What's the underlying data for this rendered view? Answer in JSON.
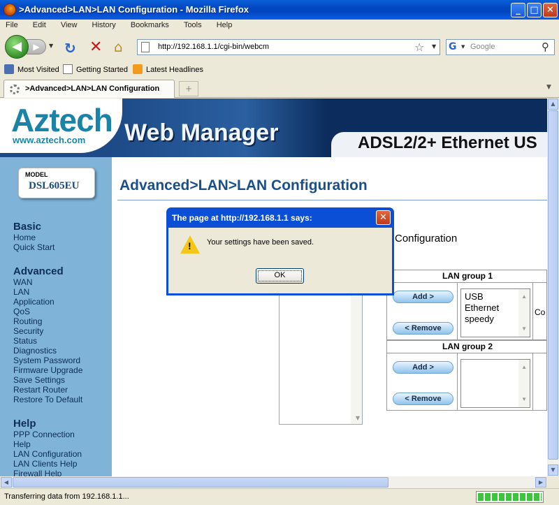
{
  "window": {
    "title": ">Advanced>LAN>LAN Configuration - Mozilla Firefox",
    "controls": {
      "minimize": "_",
      "maximize": "□",
      "close": "✕"
    }
  },
  "menu": [
    "File",
    "Edit",
    "View",
    "History",
    "Bookmarks",
    "Tools",
    "Help"
  ],
  "nav": {
    "url": "http://192.168.1.1/cgi-bin/webcm",
    "search_placeholder": "Google"
  },
  "bookmarks": [
    "Most Visited",
    "Getting Started",
    "Latest Headlines"
  ],
  "tab": {
    "label": ">Advanced>LAN>LAN Configuration",
    "new_tab": "+"
  },
  "banner": {
    "brand": "Aztech",
    "brand_url": "www.aztech.com",
    "product_line": "Web Manager",
    "product": "ADSL2/2+ Ethernet US"
  },
  "model": {
    "label": "MODEL",
    "name": "DSL605EU"
  },
  "sidebar": {
    "basic": {
      "title": "Basic",
      "items": [
        "Home",
        "Quick Start"
      ]
    },
    "advanced": {
      "title": "Advanced",
      "items": [
        "WAN",
        "LAN",
        "Application",
        "QoS",
        "Routing",
        "Security",
        "Status",
        "Diagnostics",
        "System Password",
        "Firmware Upgrade",
        "Save Settings",
        "Restart Router",
        "Restore To Default"
      ]
    },
    "help": {
      "title": "Help",
      "items": [
        "PPP Connection",
        "Help",
        "LAN Configuration",
        "LAN Clients Help",
        "Firewall Help"
      ]
    }
  },
  "main": {
    "page_title": "Advanced>LAN>LAN Configuration",
    "section": "Configuration",
    "groups": [
      {
        "title": "LAN group 1",
        "add": "Add >",
        "remove": "< Remove",
        "members": [
          "USB",
          "Ethernet",
          "speedy"
        ],
        "side_text": "Co"
      },
      {
        "title": "LAN group 2",
        "add": "Add >",
        "remove": "< Remove",
        "members": []
      }
    ]
  },
  "dialog": {
    "title": "The page at http://192.168.1.1 says:",
    "message": "Your settings have been saved.",
    "ok": "OK"
  },
  "status": {
    "text": "Transferring data from 192.168.1.1...",
    "progress": 1.0
  }
}
